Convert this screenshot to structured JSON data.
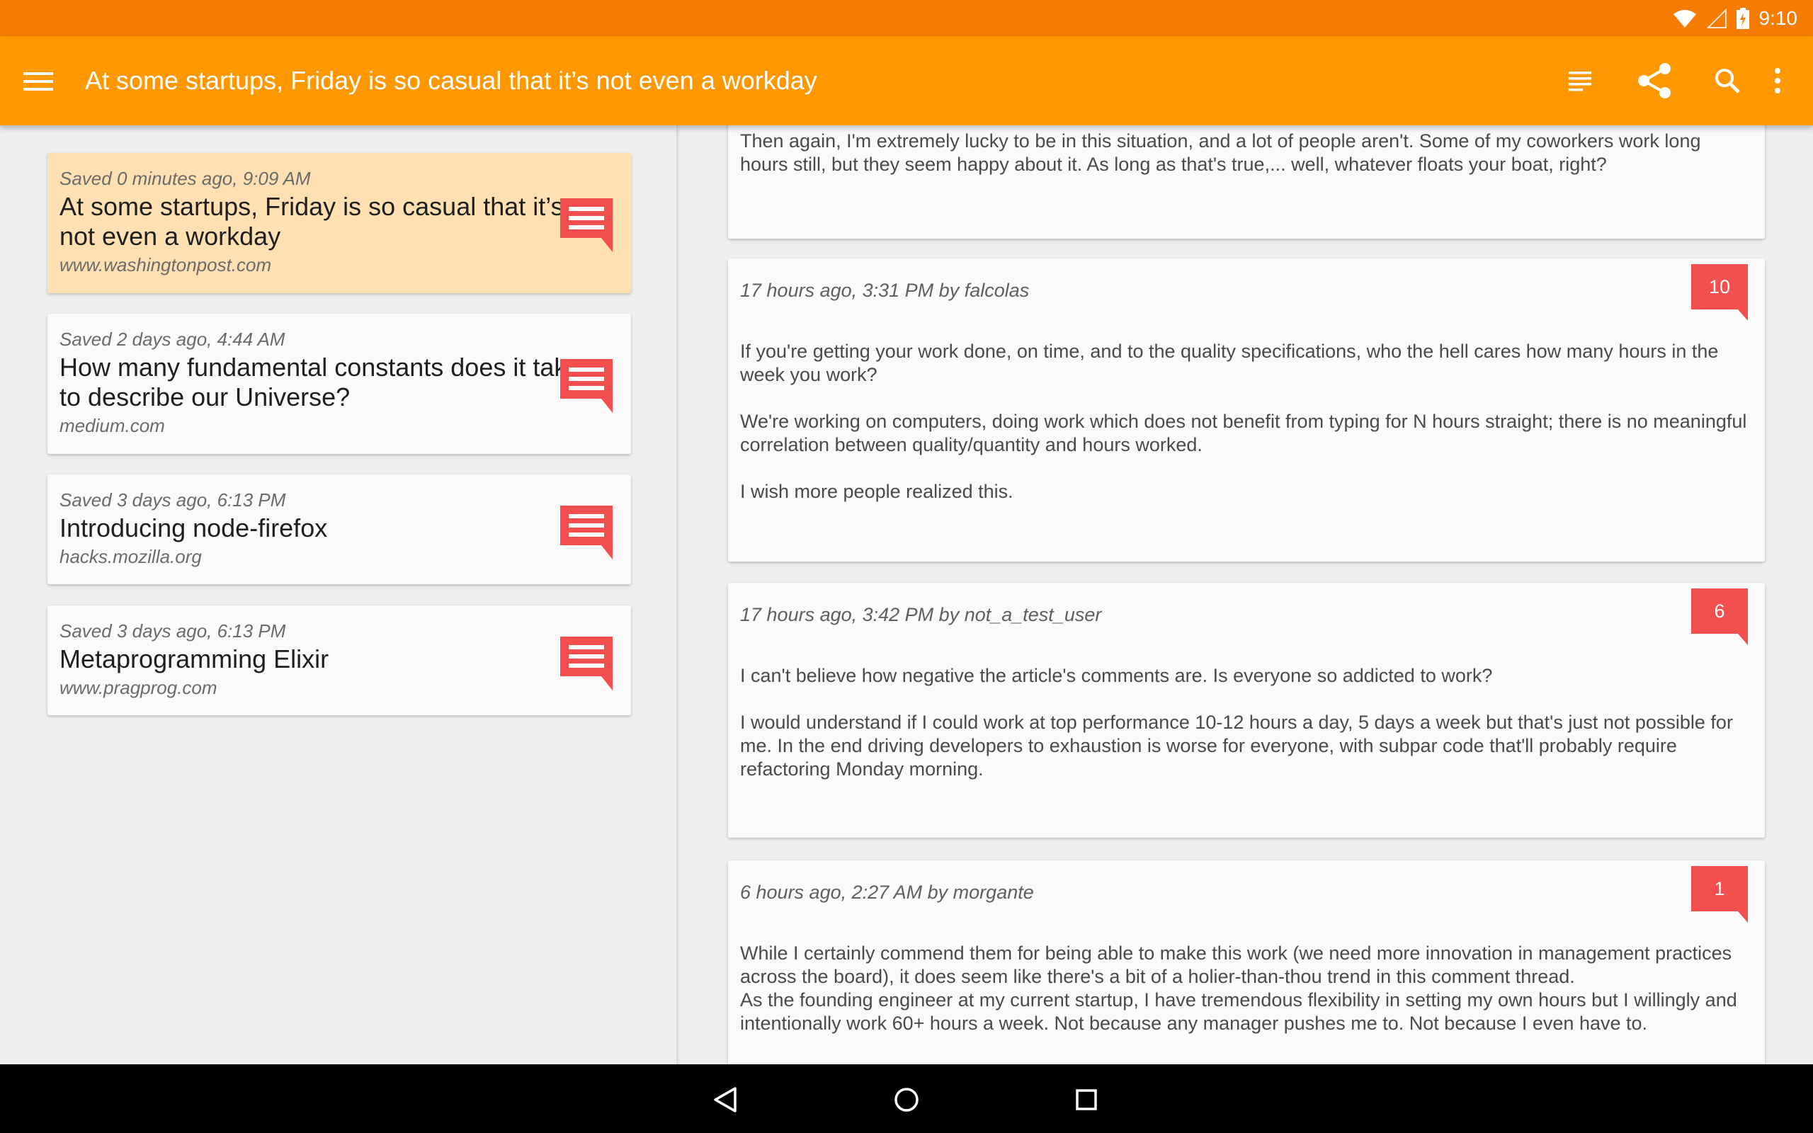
{
  "status": {
    "time": "9:10"
  },
  "appbar": {
    "title": "At some startups, Friday is so casual that it’s not even a workday",
    "color": "#ff9800",
    "actions": [
      "reader-view-icon",
      "share-icon",
      "search-icon",
      "overflow-menu-icon"
    ]
  },
  "articles": [
    {
      "meta": "Saved 0 minutes ago, 9:09 AM",
      "title": "At some startups, Friday is so casual that it’s not even a workday",
      "domain": "www.washingtonpost.com",
      "selected": true
    },
    {
      "meta": "Saved 2 days ago, 4:44 AM",
      "title": "How many fundamental constants does it take to describe our Universe?",
      "domain": "medium.com",
      "selected": false
    },
    {
      "meta": "Saved 3 days ago, 6:13 PM",
      "title": "Introducing node-firefox",
      "domain": "hacks.mozilla.org",
      "selected": false
    },
    {
      "meta": "Saved 3 days ago, 6:13 PM",
      "title": "Metaprogramming Elixir",
      "domain": "www.pragprog.com",
      "selected": false
    }
  ],
  "comments": [
    {
      "paragraphs": [
        "Then again, I'm extremely lucky to be in this situation, and a lot of people aren't. Some of my coworkers work long hours still, but they seem happy about it. As long as that's true,... well, whatever floats your boat, right?"
      ]
    },
    {
      "meta": "17 hours ago, 3:31 PM by falcolas",
      "replies": "10",
      "paragraphs": [
        "If you're getting your work done, on time, and to the quality specifications, who the hell cares how many hours in the week you work?",
        "We're working on computers, doing work which does not benefit from typing for N hours straight; there is no meaningful correlation between quality/quantity and hours worked.",
        "I wish more people realized this."
      ]
    },
    {
      "meta": "17 hours ago, 3:42 PM by not_a_test_user",
      "replies": "6",
      "paragraphs": [
        "I can't believe how negative the article's comments are. Is everyone so addicted to work?",
        "I would understand if I could work at top performance 10-12 hours a day, 5 days a week but that's just not possible for me. In the end driving developers to exhaustion is worse for everyone, with subpar code that'll probably require refactoring Monday morning."
      ]
    },
    {
      "meta": "6 hours ago, 2:27 AM by morgante",
      "replies": "1",
      "paragraphs": [
        "While I certainly commend them for being able to make this work (we need more innovation in management practices across the board), it does seem like there's a bit of a holier-than-thou trend in this comment thread.",
        "As the founding engineer at my current startup, I have tremendous flexibility in setting my own hours but I willingly and intentionally work 60+ hours a week. Not because any manager pushes me to. Not because I even have to."
      ]
    }
  ],
  "colors": {
    "accent": "#ff9800",
    "statusbar": "#f57c00",
    "badge": "#f44f4f",
    "selected": "#ffe0b2"
  },
  "navbar": {
    "buttons": [
      "back-icon",
      "home-icon",
      "recents-icon"
    ]
  }
}
